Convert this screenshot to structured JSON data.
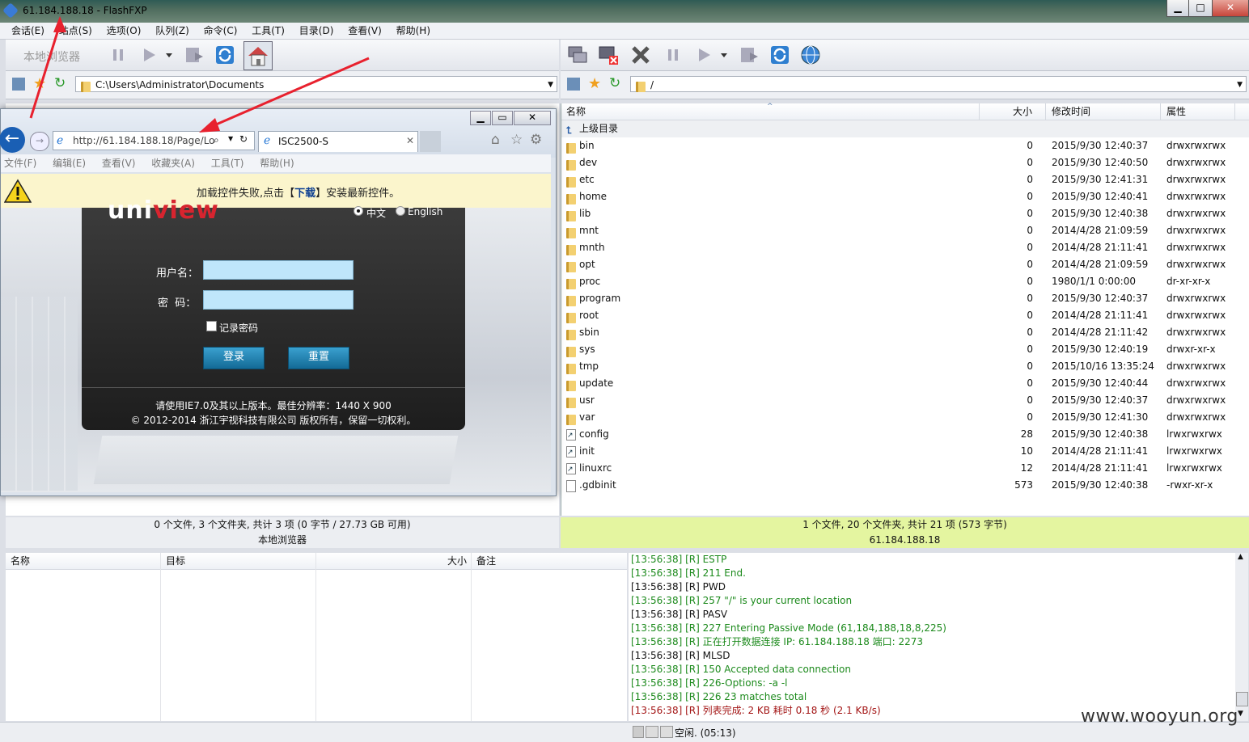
{
  "window": {
    "title": "61.184.188.18 - FlashFXP"
  },
  "menu": [
    "会话(E)",
    "站点(S)",
    "选项(O)",
    "队列(Z)",
    "命令(C)",
    "工具(T)",
    "目录(D)",
    "查看(V)",
    "帮助(H)"
  ],
  "left": {
    "toolbar_label": "本地浏览器",
    "path": "C:\\Users\\Administrator\\Documents",
    "status": "0 个文件, 3 个文件夹, 共计 3 项 (0 字节 / 27.73 GB 可用)",
    "footer": "本地浏览器"
  },
  "right": {
    "path": "/",
    "columns": {
      "name": "名称",
      "size": "大小",
      "modified": "修改时间",
      "attr": "属性"
    },
    "parent": "上级目录",
    "files": [
      {
        "name": "bin",
        "size": "0",
        "date": "2015/9/30 12:40:37",
        "attr": "drwxrwxrwx",
        "kind": "folder"
      },
      {
        "name": "dev",
        "size": "0",
        "date": "2015/9/30 12:40:50",
        "attr": "drwxrwxrwx",
        "kind": "folder"
      },
      {
        "name": "etc",
        "size": "0",
        "date": "2015/9/30 12:41:31",
        "attr": "drwxrwxrwx",
        "kind": "folder"
      },
      {
        "name": "home",
        "size": "0",
        "date": "2015/9/30 12:40:41",
        "attr": "drwxrwxrwx",
        "kind": "folder"
      },
      {
        "name": "lib",
        "size": "0",
        "date": "2015/9/30 12:40:38",
        "attr": "drwxrwxrwx",
        "kind": "folder"
      },
      {
        "name": "mnt",
        "size": "0",
        "date": "2014/4/28 21:09:59",
        "attr": "drwxrwxrwx",
        "kind": "folder"
      },
      {
        "name": "mnth",
        "size": "0",
        "date": "2014/4/28 21:11:41",
        "attr": "drwxrwxrwx",
        "kind": "folder"
      },
      {
        "name": "opt",
        "size": "0",
        "date": "2014/4/28 21:09:59",
        "attr": "drwxrwxrwx",
        "kind": "folder"
      },
      {
        "name": "proc",
        "size": "0",
        "date": "1980/1/1 0:00:00",
        "attr": "dr-xr-xr-x",
        "kind": "folder"
      },
      {
        "name": "program",
        "size": "0",
        "date": "2015/9/30 12:40:37",
        "attr": "drwxrwxrwx",
        "kind": "folder"
      },
      {
        "name": "root",
        "size": "0",
        "date": "2014/4/28 21:11:41",
        "attr": "drwxrwxrwx",
        "kind": "folder"
      },
      {
        "name": "sbin",
        "size": "0",
        "date": "2014/4/28 21:11:42",
        "attr": "drwxrwxrwx",
        "kind": "folder"
      },
      {
        "name": "sys",
        "size": "0",
        "date": "2015/9/30 12:40:19",
        "attr": "drwxr-xr-x",
        "kind": "folder"
      },
      {
        "name": "tmp",
        "size": "0",
        "date": "2015/10/16 13:35:24",
        "attr": "drwxrwxrwx",
        "kind": "folder"
      },
      {
        "name": "update",
        "size": "0",
        "date": "2015/9/30 12:40:44",
        "attr": "drwxrwxrwx",
        "kind": "folder"
      },
      {
        "name": "usr",
        "size": "0",
        "date": "2015/9/30 12:40:37",
        "attr": "drwxrwxrwx",
        "kind": "folder"
      },
      {
        "name": "var",
        "size": "0",
        "date": "2015/9/30 12:41:30",
        "attr": "drwxrwxrwx",
        "kind": "folder"
      },
      {
        "name": "config",
        "size": "28",
        "date": "2015/9/30 12:40:38",
        "attr": "lrwxrwxrwx",
        "kind": "link"
      },
      {
        "name": "init",
        "size": "10",
        "date": "2014/4/28 21:11:41",
        "attr": "lrwxrwxrwx",
        "kind": "link"
      },
      {
        "name": "linuxrc",
        "size": "12",
        "date": "2014/4/28 21:11:41",
        "attr": "lrwxrwxrwx",
        "kind": "link"
      },
      {
        "name": ".gdbinit",
        "size": "573",
        "date": "2015/9/30 12:40:38",
        "attr": "-rwxr-xr-x",
        "kind": "file"
      }
    ],
    "status": "1 个文件, 20 个文件夹, 共计 21 项 (573 字节)",
    "footer": "61.184.188.18"
  },
  "queue": {
    "columns": {
      "name": "名称",
      "target": "目标",
      "size": "大小",
      "note": "备注"
    }
  },
  "log": [
    {
      "t": "[13:56:38]  [R]  ESTP",
      "c": "lg"
    },
    {
      "t": "[13:56:38]  [R]  211 End.",
      "c": "lg"
    },
    {
      "t": "[13:56:38]  [R]  PWD",
      "c": "lb"
    },
    {
      "t": "[13:56:38]  [R]  257 \"/\" is your current location",
      "c": "lg"
    },
    {
      "t": "[13:56:38]  [R]  PASV",
      "c": "lb"
    },
    {
      "t": "[13:56:38]  [R]  227 Entering Passive Mode (61,184,188,18,8,225)",
      "c": "lg"
    },
    {
      "t": "[13:56:38]  [R]  正在打开数据连接 IP: 61.184.188.18 端口: 2273",
      "c": "lg"
    },
    {
      "t": "[13:56:38]  [R]  MLSD",
      "c": "lb"
    },
    {
      "t": "[13:56:38]  [R]  150 Accepted data connection",
      "c": "lg"
    },
    {
      "t": "[13:56:38]  [R]  226-Options: -a -l",
      "c": "lg"
    },
    {
      "t": "[13:56:38]  [R]  226 23 matches total",
      "c": "lg"
    },
    {
      "t": "[13:56:38]  [R]  列表完成: 2 KB 耗时 0.18 秒 (2.1 KB/s)",
      "c": "lr"
    }
  ],
  "statusbar": {
    "idle": "空闲. (05:13)"
  },
  "watermark": "www.wooyun.org",
  "ie": {
    "url": "http://61.184.188.18/Page/Lo",
    "tab": "ISC2500-S",
    "menu": [
      "文件(F)",
      "编辑(E)",
      "查看(V)",
      "收藏夹(A)",
      "工具(T)",
      "帮助(H)"
    ],
    "warning_pre": "加载控件失败,点击【",
    "warning_link": "下载",
    "warning_post": "】安装最新控件。",
    "brand": "uniview",
    "lang_cn": "中文",
    "lang_en": "English",
    "username_label": "用户名：",
    "password_label": "密  码：",
    "remember": "记录密码",
    "login": "登录",
    "reset": "重置",
    "notice": "请使用IE7.0及其以上版本。最佳分辨率：1440 X 900",
    "copyright": "© 2012-2014 浙江宇视科技有限公司 版权所有，保留一切权利。"
  },
  "colors": {
    "accent_green": "#e4f5a0",
    "log_green": "#1c8a1c",
    "arrow_red": "#e8212e"
  }
}
